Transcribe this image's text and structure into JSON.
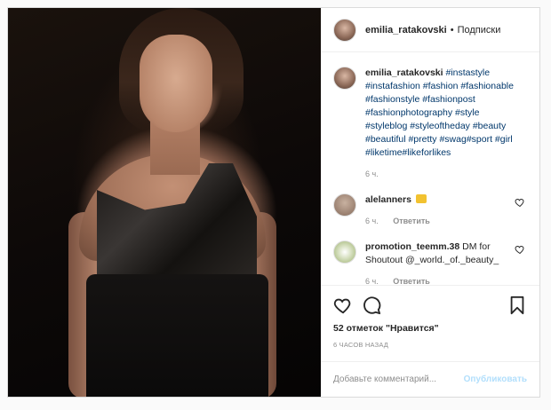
{
  "post": {
    "author": "emilia_ratakovski",
    "separator": "•",
    "follow_status": "Подписки"
  },
  "caption": {
    "author": "emilia_ratakovski",
    "hashtags": "#instastyle #instafashion #fashion #fashionable #fashionstyle #fashionpost #fashionphotography #style #styleblog #styleoftheday #beauty #beautiful #pretty #swag#sport #girl #liketime#likeforlikes",
    "time": "6 ч."
  },
  "comments": [
    {
      "author": "alelanners",
      "text": "",
      "time": "6 ч.",
      "reply": "Ответить",
      "emoji": "trophy-emoji"
    },
    {
      "author": "promotion_teemm.38",
      "text": " DM for Shoutout @_world._of._beauty_",
      "time": "6 ч.",
      "reply": "Ответить"
    }
  ],
  "actions": {
    "likes_count": "52 отметок",
    "likes_label": "\"Нравится\"",
    "posted_ago": "6 ЧАСОВ НАЗАД"
  },
  "comment_box": {
    "placeholder": "Добавьте комментарий...",
    "submit_label": "Опубликовать"
  },
  "icons": {
    "like": "heart-icon",
    "comment": "speech-bubble-icon",
    "share": "paper-plane-icon",
    "save": "bookmark-icon"
  },
  "colors": {
    "link": "#00376b",
    "muted": "#8e8e8e",
    "publish_disabled": "#b2dffc",
    "border": "#dbdbdb"
  }
}
